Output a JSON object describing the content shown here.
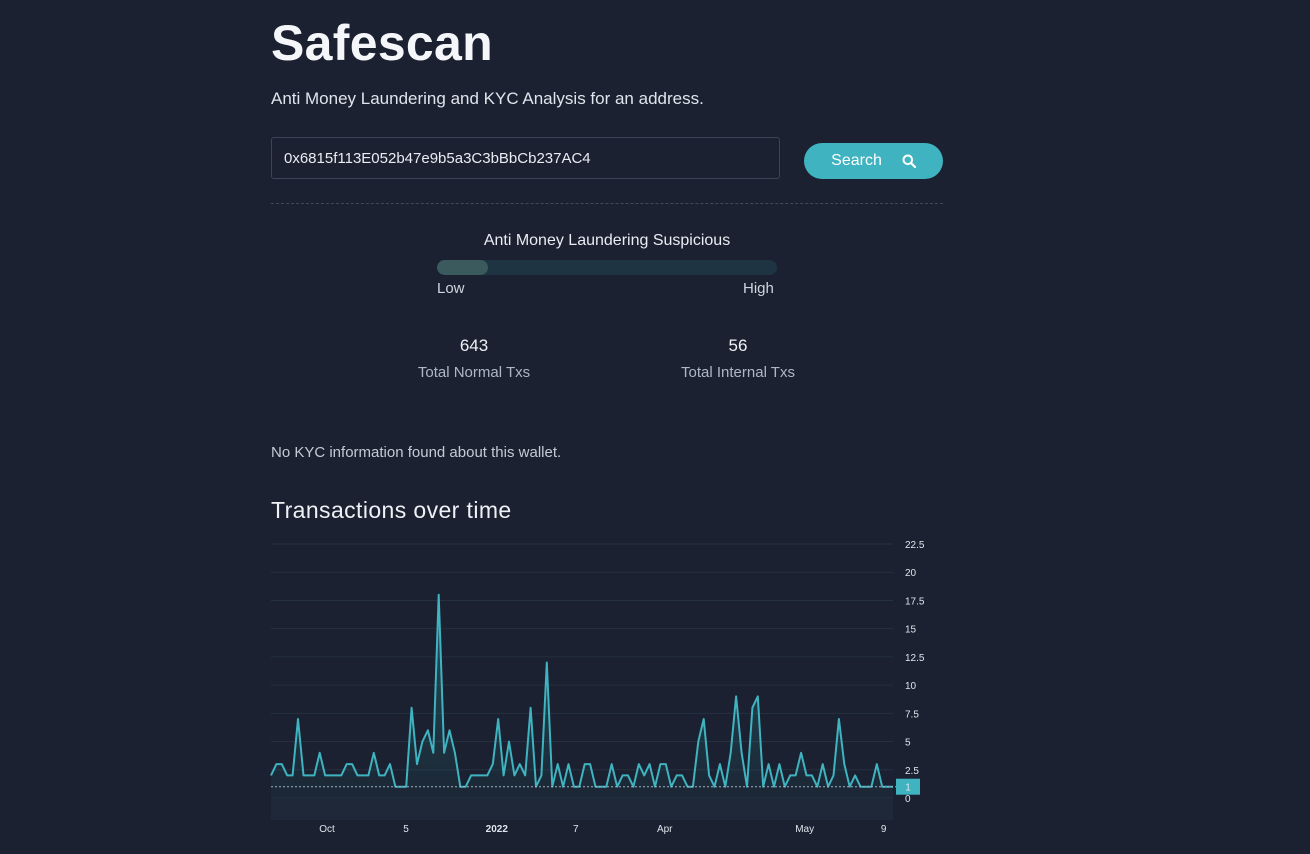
{
  "app": {
    "title": "Safescan",
    "subtitle": "Anti Money Laundering and KYC Analysis for an address."
  },
  "search": {
    "value": "0x6815f113E052b47e9b5a3C3bBbCb237AC4",
    "button_label": "Search",
    "button_icon": "search-icon"
  },
  "aml": {
    "label": "Anti Money Laundering Suspicious",
    "level": 0.15,
    "low_label": "Low",
    "high_label": "High",
    "fill_color": "#3a5a5e",
    "track_color": "#1f3442"
  },
  "stats": {
    "normal": {
      "value": "643",
      "label": "Total Normal Txs"
    },
    "internal": {
      "value": "56",
      "label": "Total Internal Txs"
    }
  },
  "kyc": {
    "message": "No KYC information found about this wallet."
  },
  "chart_section": {
    "title": "Transactions over time"
  },
  "colors": {
    "background": "#1b2130",
    "accent": "#3fb3c0"
  },
  "chart_data": {
    "type": "area",
    "ylim": [
      0,
      22.5
    ],
    "y_ticks": [
      "22.5",
      "20",
      "17.5",
      "15",
      "12.5",
      "10",
      "7.5",
      "5",
      "2.5",
      "0"
    ],
    "x_tick_labels": [
      "Oct",
      "5",
      "2022",
      "7",
      "Apr",
      "May",
      "9"
    ],
    "last_value_label": "1",
    "series": [
      {
        "values": [
          2,
          3,
          3,
          2,
          2,
          7,
          2,
          2,
          2,
          4,
          2,
          2,
          2,
          2,
          3,
          3,
          2,
          2,
          2,
          4,
          2,
          2,
          3,
          1,
          1,
          1,
          8,
          3,
          5,
          6,
          4,
          18,
          4,
          6,
          4,
          1,
          1,
          2,
          2,
          2,
          2,
          3,
          7,
          2,
          5,
          2,
          3,
          2,
          8,
          1,
          2,
          12,
          1,
          3,
          1,
          3,
          1,
          1,
          3,
          3,
          1,
          1,
          1,
          3,
          1,
          2,
          2,
          1,
          3,
          2,
          3,
          1,
          3,
          3,
          1,
          2,
          2,
          1,
          1,
          5,
          7,
          2,
          1,
          3,
          1,
          4,
          9,
          4,
          1,
          8,
          9,
          1,
          3,
          1,
          3,
          1,
          2,
          2,
          4,
          2,
          2,
          1,
          3,
          1,
          2,
          7,
          3,
          1,
          2,
          1,
          1,
          1,
          3,
          1,
          1,
          1
        ]
      }
    ]
  }
}
